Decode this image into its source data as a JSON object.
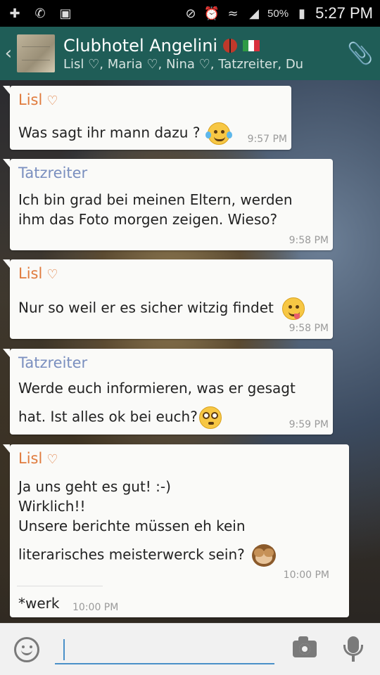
{
  "status_bar": {
    "battery_percent": "50%",
    "time": "5:27 PM",
    "icons": [
      "user-add-icon",
      "whatsapp-icon",
      "image-icon",
      "mute-icon",
      "alarm-icon",
      "wifi-icon",
      "signal-icon",
      "battery-icon"
    ]
  },
  "header": {
    "title": "Clubhotel Angelini",
    "subtitle": "Lisl ♡, Maria ♡, Nina ♡, Tatzreiter, Du",
    "icons": [
      "back-chevron-icon",
      "group-avatar",
      "ladybug-icon",
      "italy-flag-icon",
      "paperclip-icon"
    ]
  },
  "colors": {
    "header_bg": "#1f5d57",
    "sender_orange": "#e07b3d",
    "sender_blue": "#7a8fbf",
    "input_accent": "#4a90c8"
  },
  "messages": [
    {
      "sender": "Lisl",
      "heart": "♡",
      "lines": [
        "Was sagt ihr mann dazu ?"
      ],
      "emoji": "joy-tears-emoji",
      "time": "9:57 PM"
    },
    {
      "sender": "Tatzreiter",
      "lines": [
        "Ich bin grad bei meinen Eltern, werden",
        "ihm das Foto morgen zeigen. Wieso?"
      ],
      "time": "9:58 PM"
    },
    {
      "sender": "Lisl",
      "heart": "♡",
      "lines": [
        "Nur so weil er es sicher witzig findet"
      ],
      "emoji": "yum-emoji",
      "time": "9:58 PM"
    },
    {
      "sender": "Tatzreiter",
      "lines": [
        "Werde euch informieren, was er gesagt",
        "hat. Ist alles ok bei euch?"
      ],
      "emoji": "flushed-emoji",
      "time": "9:59 PM"
    },
    {
      "sender": "Lisl",
      "heart": "♡",
      "lines": [
        "Ja uns geht es gut! :-)",
        "Wirklich!!",
        "Unsere berichte müssen eh kein",
        "literarisches meisterwerck sein?"
      ],
      "emoji": "see-no-evil-monkey-emoji",
      "time": "10:00 PM",
      "followup": {
        "text": "*werk",
        "time": "10:00 PM"
      }
    }
  ],
  "input_bar": {
    "placeholder": "",
    "icons": [
      "smiley-icon",
      "camera-icon",
      "microphone-icon"
    ]
  }
}
